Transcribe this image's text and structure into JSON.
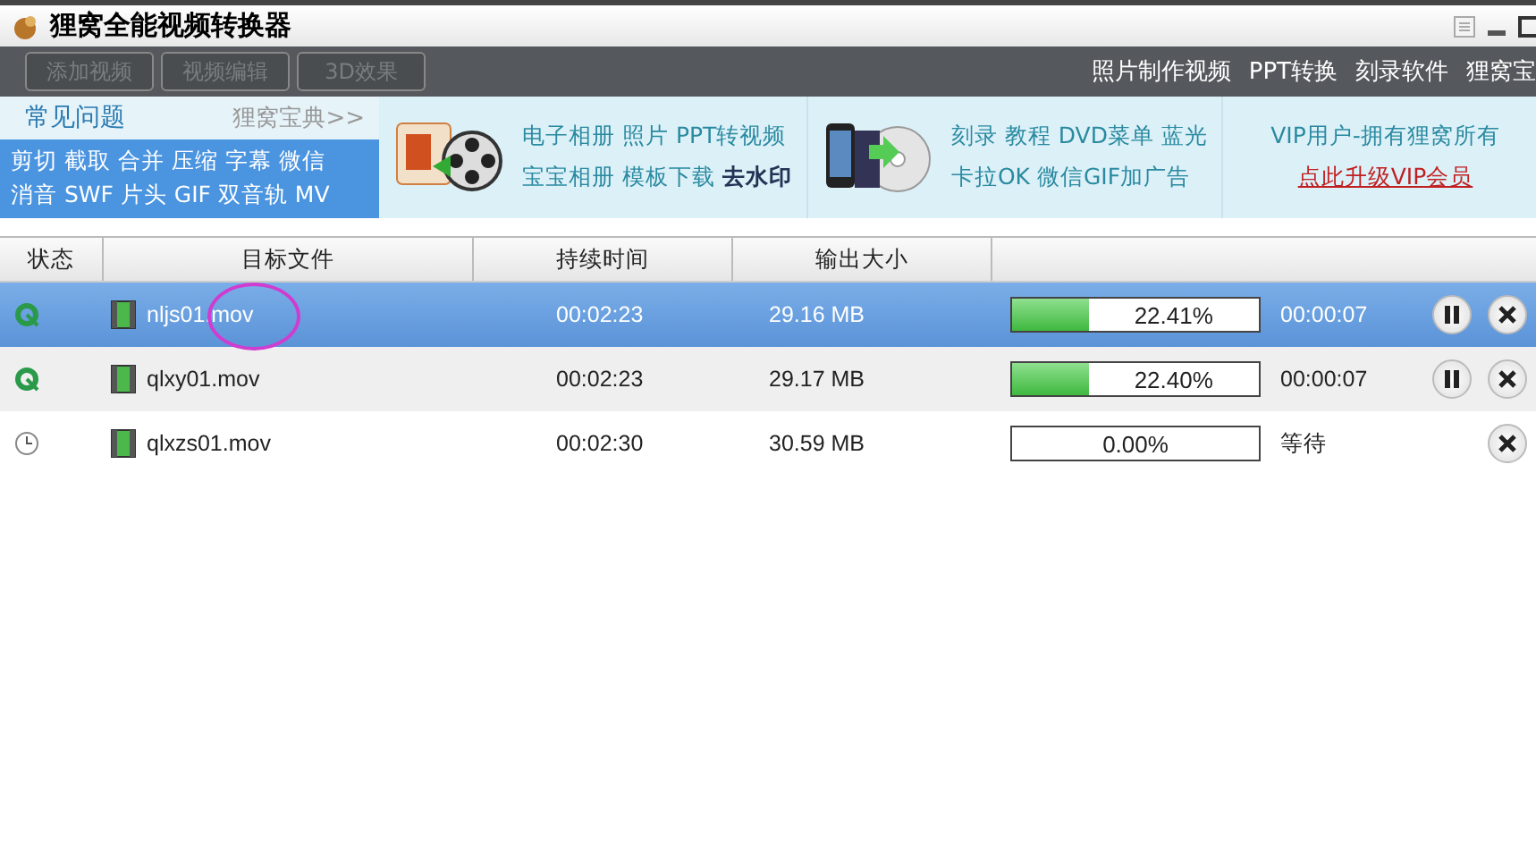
{
  "window": {
    "title": "狸窝全能视频转换器"
  },
  "toolbar": {
    "buttons": [
      {
        "label": "添加视频",
        "disabled": true
      },
      {
        "label": "视频编辑",
        "disabled": true
      },
      {
        "label": "3D效果",
        "disabled": true
      }
    ],
    "links": [
      "照片制作视频",
      "PPT转换",
      "刻录软件",
      "狸窝宝"
    ]
  },
  "banner": {
    "faq": {
      "title": "常见问题",
      "more": "狸窝宝典>>",
      "lines": [
        "剪切 截取 合并 压缩 字幕 微信",
        "消音 SWF 片头 GIF 双音轨 MV"
      ]
    },
    "promos": [
      {
        "kind": "ppt",
        "lines": [
          "电子相册 照片 PPT转视频",
          "宝宝相册 模板下载 **去水印**"
        ]
      },
      {
        "kind": "dvd",
        "lines": [
          "刻录 教程 DVD菜单 蓝光",
          "卡拉OK 微信GIF加广告"
        ]
      }
    ],
    "vip": {
      "text": "VIP用户-拥有狸窝所有",
      "link": "点此升级VIP会员"
    }
  },
  "table": {
    "columns": [
      "状态",
      "目标文件",
      "持续时间",
      "输出大小"
    ],
    "rows": [
      {
        "kind": "converting",
        "selected": true,
        "annotated": true,
        "file": "nljs01.mov",
        "duration": "00:02:23",
        "size": "29.16 MB",
        "level": 0.31,
        "percent": "22.41%",
        "remaining": "00:00:07",
        "pausable": true
      },
      {
        "kind": "converting",
        "selected": false,
        "annotated": false,
        "file": "qlxy01.mov",
        "duration": "00:02:23",
        "size": "29.17 MB",
        "level": 0.31,
        "percent": "22.40%",
        "remaining": "00:00:07",
        "pausable": true
      },
      {
        "kind": "waiting",
        "selected": false,
        "annotated": false,
        "file": "qlxzs01.mov",
        "duration": "00:02:30",
        "size": "30.59 MB",
        "level": 0,
        "percent": "0.00%",
        "remaining": "等待",
        "pausable": false
      }
    ]
  }
}
